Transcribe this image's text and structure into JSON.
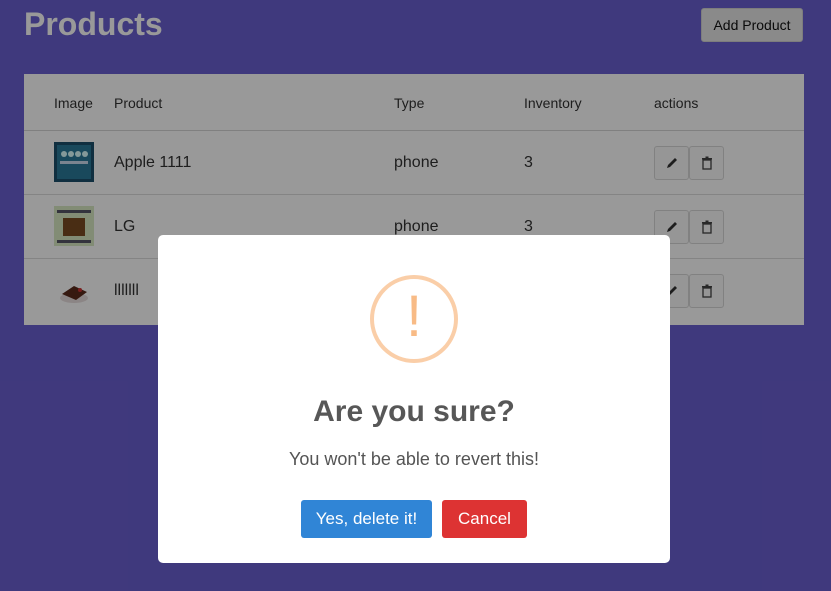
{
  "header": {
    "title": "Products",
    "add_button": "Add Product"
  },
  "table": {
    "columns": [
      "Image",
      "Product",
      "Type",
      "Inventory",
      "actions"
    ],
    "rows": [
      {
        "product": "Apple 1111",
        "type": "phone",
        "inventory": "3"
      },
      {
        "product": "LG",
        "type": "phone",
        "inventory": "3"
      },
      {
        "product": "lllllll",
        "type": "",
        "inventory": ""
      }
    ]
  },
  "dialog": {
    "icon": "!",
    "title": "Are you sure?",
    "text": "You won't be able to revert this!",
    "confirm": "Yes, delete it!",
    "cancel": "Cancel"
  },
  "colors": {
    "page_bg": "#6a5fd0",
    "confirm": "#3085d6",
    "cancel": "#dd3333",
    "warning": "#f8bb86"
  }
}
